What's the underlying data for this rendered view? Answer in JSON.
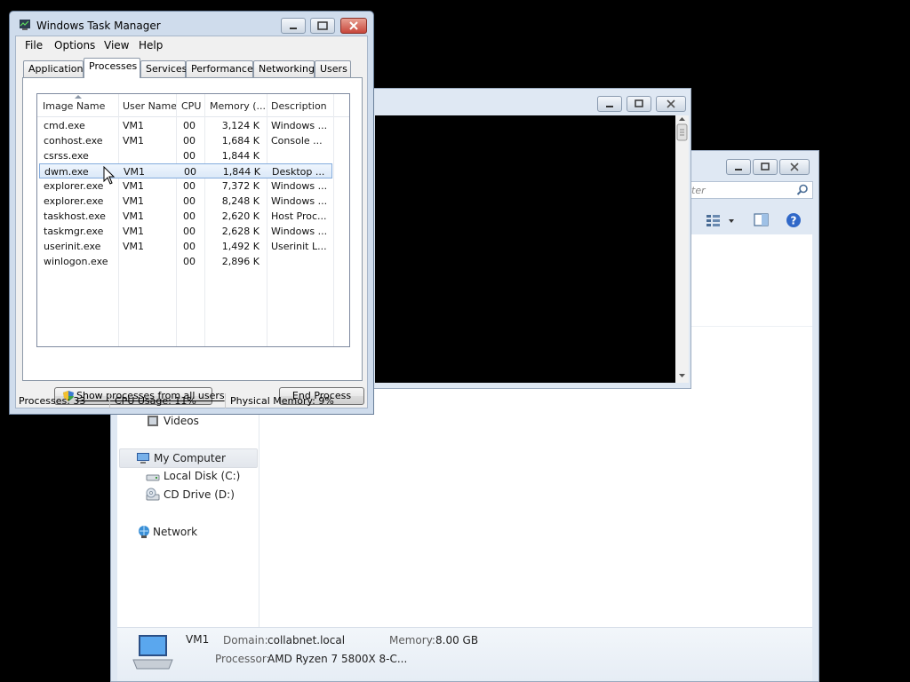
{
  "explorer": {
    "search_placeholder_fragment": "ter",
    "nav": {
      "videos": "Videos",
      "my_computer": "My Computer",
      "local_disk": "Local Disk (C:)",
      "cd_drive": "CD Drive (D:)",
      "network": "Network"
    },
    "details": {
      "name": "VM1",
      "domain_label": "Domain:",
      "domain_value": "collabnet.local",
      "memory_label": "Memory:",
      "memory_value": "8.00 GB",
      "processor_label": "Processor:",
      "processor_value": "AMD Ryzen 7 5800X 8-C..."
    }
  },
  "taskmgr": {
    "title": "Windows Task Manager",
    "menu": [
      "File",
      "Options",
      "View",
      "Help"
    ],
    "tabs": [
      "Applications",
      "Processes",
      "Services",
      "Performance",
      "Networking",
      "Users"
    ],
    "active_tab": "Processes",
    "columns": [
      "Image Name",
      "User Name",
      "CPU",
      "Memory (...",
      "Description"
    ],
    "rows": [
      {
        "image": "cmd.exe",
        "user": "VM1",
        "cpu": "00",
        "mem": "3,124 K",
        "desc": "Windows ..."
      },
      {
        "image": "conhost.exe",
        "user": "VM1",
        "cpu": "00",
        "mem": "1,684 K",
        "desc": "Console ..."
      },
      {
        "image": "csrss.exe",
        "user": "",
        "cpu": "00",
        "mem": "1,844 K",
        "desc": ""
      },
      {
        "image": "dwm.exe",
        "user": "VM1",
        "cpu": "00",
        "mem": "1,844 K",
        "desc": "Desktop ..."
      },
      {
        "image": "explorer.exe",
        "user": "VM1",
        "cpu": "00",
        "mem": "7,372 K",
        "desc": "Windows ..."
      },
      {
        "image": "explorer.exe",
        "user": "VM1",
        "cpu": "00",
        "mem": "8,248 K",
        "desc": "Windows ..."
      },
      {
        "image": "taskhost.exe",
        "user": "VM1",
        "cpu": "00",
        "mem": "2,620 K",
        "desc": "Host Proc..."
      },
      {
        "image": "taskmgr.exe",
        "user": "VM1",
        "cpu": "00",
        "mem": "2,628 K",
        "desc": "Windows ..."
      },
      {
        "image": "userinit.exe",
        "user": "VM1",
        "cpu": "00",
        "mem": "1,492 K",
        "desc": "Userinit L..."
      },
      {
        "image": "winlogon.exe",
        "user": "",
        "cpu": "00",
        "mem": "2,896 K",
        "desc": ""
      }
    ],
    "selected_row": 3,
    "show_all_button": "Show processes from all users",
    "end_process_button": "End Process",
    "status": {
      "processes": "Processes: 33",
      "cpu": "CPU Usage: 11%",
      "memory": "Physical Memory: 9%"
    }
  },
  "colors": {
    "selection_border": "#84acdd",
    "close_button": "#c8473b",
    "title_bar": "#cfdcec"
  }
}
